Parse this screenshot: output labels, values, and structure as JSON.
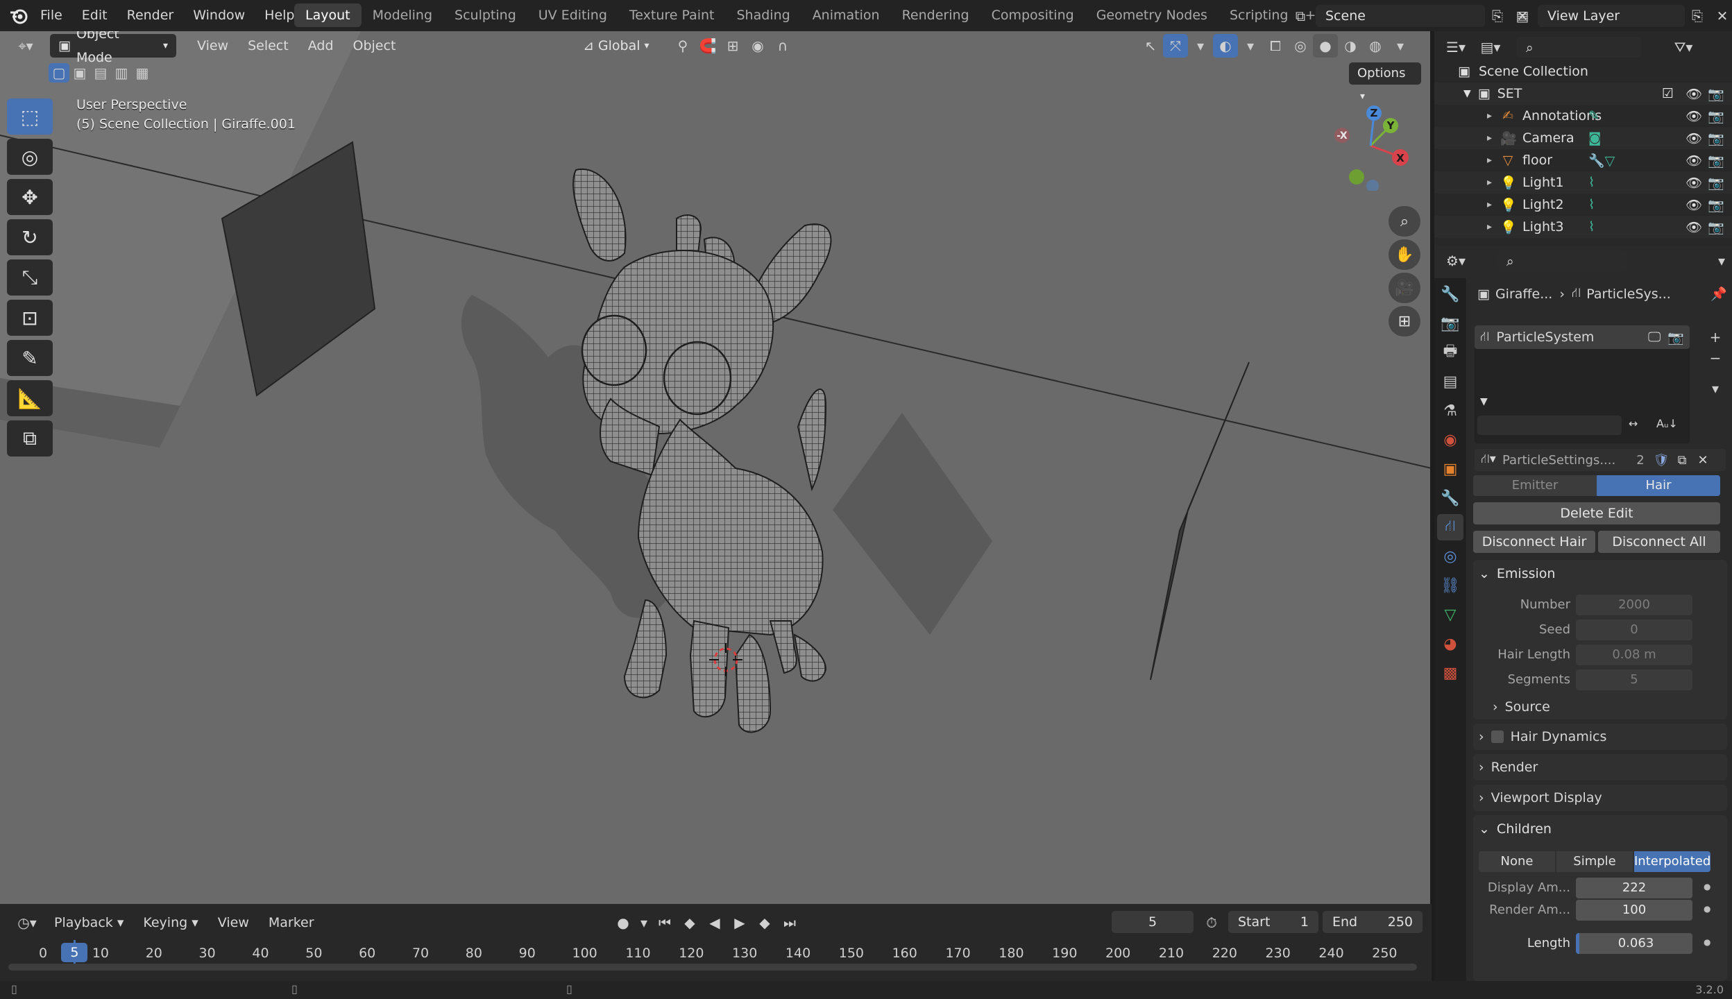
{
  "menubar": {
    "items": [
      "File",
      "Edit",
      "Render",
      "Window",
      "Help"
    ],
    "workspaces": [
      "Layout",
      "Modeling",
      "Sculpting",
      "UV Editing",
      "Texture Paint",
      "Shading",
      "Animation",
      "Rendering",
      "Compositing",
      "Geometry Nodes",
      "Scripting"
    ],
    "active_workspace": "Layout",
    "add_tab": "+",
    "scene_label": "Scene",
    "view_layer_label": "View Layer"
  },
  "viewport": {
    "mode": "Object Mode",
    "menus": [
      "View",
      "Select",
      "Add",
      "Object"
    ],
    "orientation": "Global",
    "options_label": "Options",
    "perspective": "User Perspective",
    "collection_path": "(5) Scene Collection | Giraffe.001",
    "gizmo": {
      "z": "Z",
      "y": "Y",
      "x": "X",
      "neg_x": "-X"
    },
    "background_color": "#6b6b6b"
  },
  "timeline": {
    "menus": [
      "Playback",
      "Keying",
      "View",
      "Marker"
    ],
    "current_frame": "5",
    "start_label": "Start",
    "start_value": "1",
    "end_label": "End",
    "end_value": "250",
    "ruler": [
      "0",
      "5",
      "10",
      "20",
      "30",
      "40",
      "50",
      "60",
      "70",
      "80",
      "90",
      "100",
      "110",
      "120",
      "130",
      "140",
      "150",
      "160",
      "170",
      "180",
      "190",
      "200",
      "210",
      "220",
      "230",
      "240",
      "250"
    ],
    "playhead_frame": 5
  },
  "outliner": {
    "root": "Scene Collection",
    "collection": "SET",
    "items": [
      {
        "name": "Annotations",
        "icon": "annotation-icon"
      },
      {
        "name": "Camera",
        "icon": "camera-icon"
      },
      {
        "name": "floor",
        "icon": "mesh-icon"
      },
      {
        "name": "Light1",
        "icon": "light-icon"
      },
      {
        "name": "Light2",
        "icon": "light-icon"
      },
      {
        "name": "Light3",
        "icon": "light-icon"
      }
    ]
  },
  "properties": {
    "breadcrumb_object": "Giraffe...",
    "breadcrumb_system": "ParticleSys...",
    "particle_system": "ParticleSystem",
    "settings_name": "ParticleSettings....",
    "settings_users": "2",
    "type_emitter": "Emitter",
    "type_hair": "Hair",
    "delete_edit": "Delete Edit",
    "disconnect_hair": "Disconnect Hair",
    "disconnect_all": "Disconnect All",
    "emission": {
      "title": "Emission",
      "number_label": "Number",
      "number_value": "2000",
      "seed_label": "Seed",
      "seed_value": "0",
      "hair_length_label": "Hair Length",
      "hair_length_value": "0.08 m",
      "segments_label": "Segments",
      "segments_value": "5",
      "source_label": "Source"
    },
    "hair_dynamics": "Hair Dynamics",
    "render": "Render",
    "viewport_display": "Viewport Display",
    "children": {
      "title": "Children",
      "modes": [
        "None",
        "Simple",
        "Interpolated"
      ],
      "active_mode": "Interpolated",
      "display_amount_label": "Display Am...",
      "display_amount_value": "222",
      "render_amount_label": "Render Am...",
      "render_amount_value": "100",
      "length_label": "Length",
      "length_value": "0.063"
    }
  },
  "status": {
    "version": "3.2.0"
  },
  "colors": {
    "accent": "#4772b3",
    "active_tab": "#3d3d3d",
    "panel": "#303030"
  }
}
